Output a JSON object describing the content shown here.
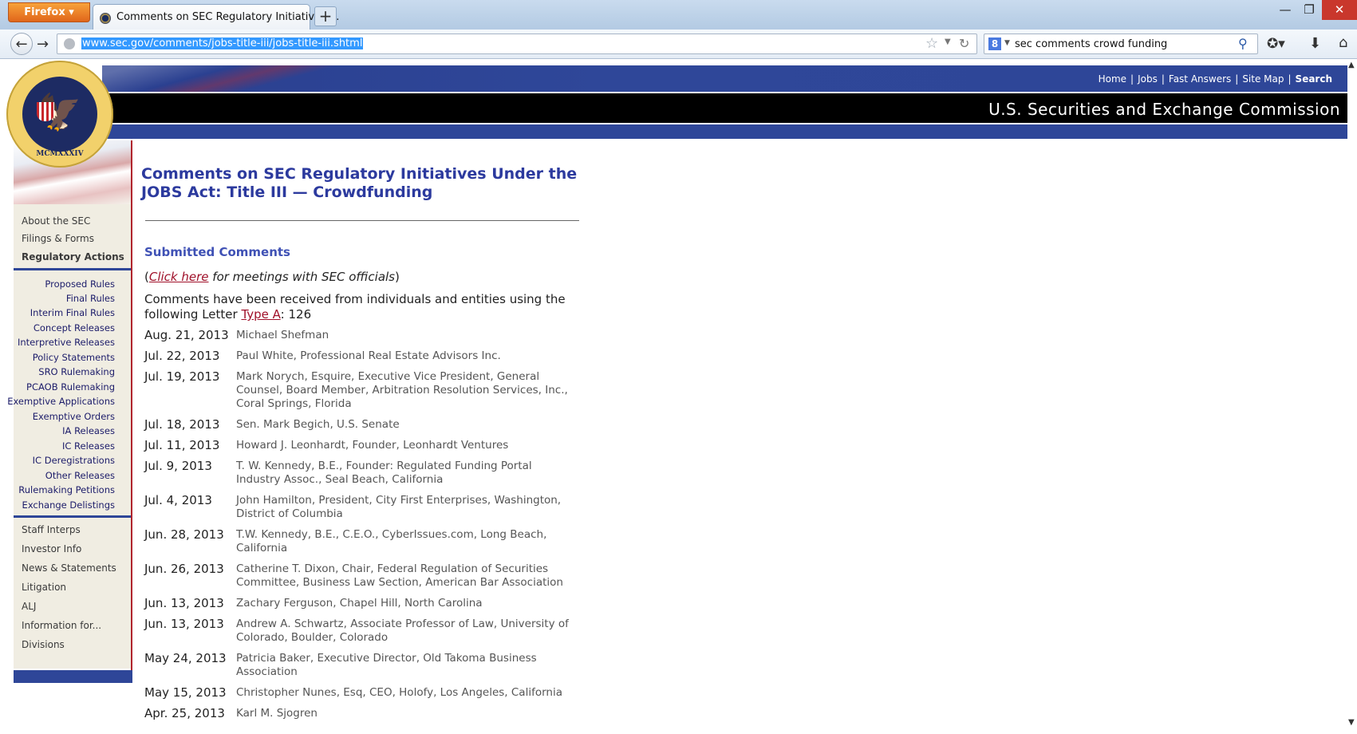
{
  "browser": {
    "menu_label": "Firefox ▾",
    "tab_title": "Comments on SEC Regulatory Initiatives ...",
    "new_tab_label": "+",
    "url": "www.sec.gov/comments/jobs-title-iii/jobs-title-iii.shtml",
    "search_engine": "8",
    "search_query": "sec comments crowd funding",
    "window_buttons": {
      "minimize": "—",
      "maximize": "❐",
      "close": "✕"
    }
  },
  "header": {
    "top_nav": [
      "Home",
      "Jobs",
      "Fast Answers",
      "Site Map",
      "Search"
    ],
    "agency_name": "U.S. Securities and Exchange Commission",
    "seal_text": "MCMXXXIV"
  },
  "sidebar": {
    "top_items": [
      "About the SEC",
      "Filings & Forms",
      "Regulatory Actions"
    ],
    "sub_items": [
      "Proposed Rules",
      "Final Rules",
      "Interim Final Rules",
      "Concept Releases",
      "Interpretive Releases",
      "Policy Statements",
      "SRO Rulemaking",
      "PCAOB Rulemaking",
      "Exemptive Applications",
      "Exemptive Orders",
      "IA Releases",
      "IC Releases",
      "IC Deregistrations",
      "Other Releases",
      "Rulemaking Petitions",
      "Exchange Delistings"
    ],
    "bottom_items": [
      "Staff Interps",
      "Investor Info",
      "News & Statements",
      "Litigation",
      "ALJ",
      "Information for...",
      "Divisions"
    ]
  },
  "main": {
    "heading": "Comments on SEC Regulatory Initiatives Under the JOBS Act: Title III — Crowdfunding",
    "submitted_heading": "Submitted Comments",
    "meetings_prefix": "(",
    "meetings_link": "Click here",
    "meetings_suffix": " for meetings with SEC officials",
    "meetings_close": ")",
    "intro_text": "Comments have been received from individuals and entities using the following Letter ",
    "intro_link": "Type A",
    "intro_count": ": 126",
    "comments": [
      {
        "date": "Aug. 21, 2013",
        "name": "Michael Shefman"
      },
      {
        "date": "Jul. 22, 2013",
        "name": "Paul White, Professional Real Estate Advisors Inc."
      },
      {
        "date": "Jul. 19, 2013",
        "name": "Mark Norych, Esquire, Executive Vice President, General Counsel, Board Member, Arbitration Resolution Services, Inc., Coral Springs, Florida"
      },
      {
        "date": "Jul. 18, 2013",
        "name": "Sen. Mark Begich, U.S. Senate"
      },
      {
        "date": "Jul. 11, 2013",
        "name": "Howard J. Leonhardt, Founder, Leonhardt Ventures"
      },
      {
        "date": "Jul. 9, 2013",
        "name": "T. W. Kennedy, B.E., Founder: Regulated Funding Portal Industry Assoc., Seal Beach, California"
      },
      {
        "date": "Jul. 4, 2013",
        "name": "John Hamilton, President, City First Enterprises, Washington, District of Columbia"
      },
      {
        "date": "Jun. 28, 2013",
        "name": "T.W. Kennedy, B.E., C.E.O., CyberIssues.com, Long Beach, California"
      },
      {
        "date": "Jun. 26, 2013",
        "name": "Catherine T. Dixon, Chair, Federal Regulation of Securities Committee, Business Law Section, American Bar Association"
      },
      {
        "date": "Jun. 13, 2013",
        "name": "Zachary Ferguson, Chapel Hill, North Carolina"
      },
      {
        "date": "Jun. 13, 2013",
        "name": "Andrew A. Schwartz, Associate Professor of Law, University of Colorado, Boulder, Colorado"
      },
      {
        "date": "May 24, 2013",
        "name": "Patricia Baker, Executive Director, Old Takoma Business Association"
      },
      {
        "date": "May 15, 2013",
        "name": "Christopher Nunes, Esq, CEO, Holofy, Los Angeles, California"
      },
      {
        "date": "Apr. 25, 2013",
        "name": "Karl M. Sjogren"
      }
    ]
  },
  "colors": {
    "sec_blue": "#2e4698",
    "heading_blue": "#2c3a9e",
    "link_red": "#a0112a",
    "sidebar_bg": "#f0ede2"
  }
}
